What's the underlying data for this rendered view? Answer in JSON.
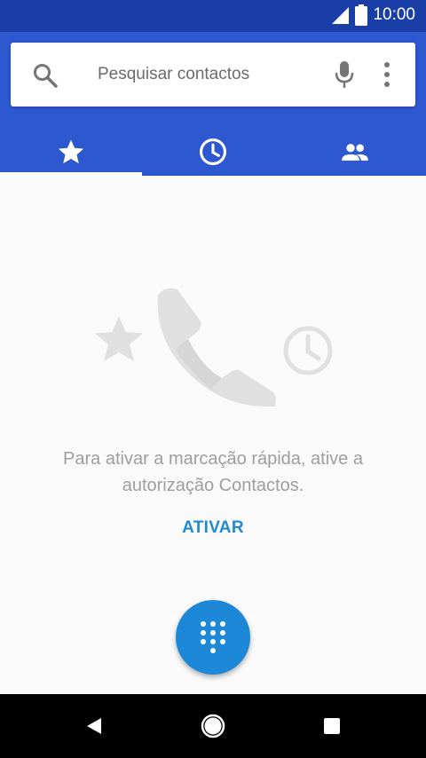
{
  "status_bar": {
    "time": "10:00",
    "icons": [
      "signal-icon",
      "battery-icon"
    ]
  },
  "search": {
    "placeholder": "Pesquisar contactos",
    "icons": [
      "search-icon",
      "mic-icon",
      "more-vert-icon"
    ]
  },
  "tabs": [
    {
      "icon": "star-icon",
      "active": true
    },
    {
      "icon": "clock-icon",
      "active": false
    },
    {
      "icon": "people-icon",
      "active": false
    }
  ],
  "empty_state": {
    "illustration": [
      "star-icon",
      "phone-icon",
      "clock-icon"
    ],
    "message": "Para ativar a marcação rápida, ative a autorização Contactos.",
    "action_label": "ATIVAR"
  },
  "fab": {
    "icon": "dialpad-icon"
  },
  "nav": {
    "icons": [
      "back-icon",
      "home-icon",
      "recents-icon"
    ]
  },
  "colors": {
    "status_bar": "#1a3ea8",
    "app_bar": "#2d58cf",
    "accent": "#1e88d8",
    "action_text": "#1e8bd4",
    "background": "#fafafa"
  }
}
